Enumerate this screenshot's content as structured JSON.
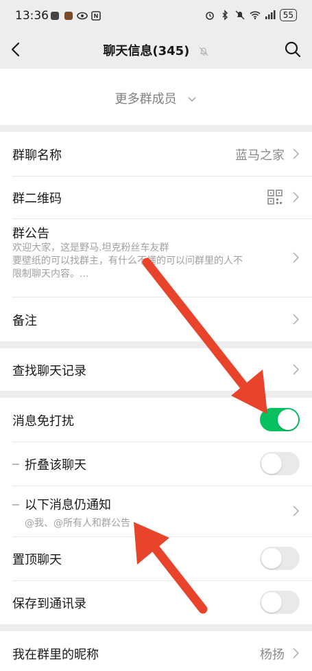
{
  "status_bar": {
    "time": "13:36",
    "battery": "55"
  },
  "nav": {
    "title": "聊天信息(345)"
  },
  "members": {
    "more_label": "更多群成员"
  },
  "group_info": {
    "name_label": "群聊名称",
    "name_value": "蓝马之家",
    "qr_label": "群二维码",
    "notice_label": "群公告",
    "notice_lines": [
      "欢迎大家，这是野马.坦克粉丝车友群",
      "要壁纸的可以找群主，有什么不懂的可以问群里的人不",
      "限制聊天内容。..."
    ],
    "remark_label": "备注"
  },
  "search": {
    "label": "查找聊天记录"
  },
  "settings": {
    "dnd_label": "消息免打扰",
    "dnd_on": true,
    "fold_label": "折叠该聊天",
    "fold_on": false,
    "notify_label": "以下消息仍通知",
    "notify_sub": "@我、@所有人和群公告",
    "pin_label": "置顶聊天",
    "pin_on": false,
    "save_label": "保存到通讯录",
    "save_on": false
  },
  "nickname": {
    "label": "我在群里的昵称",
    "value": "杨扬"
  },
  "annotations": {
    "arrow_color": "#e8432b"
  },
  "colors": {
    "accent_green": "#07c160",
    "background": "#ededed"
  }
}
